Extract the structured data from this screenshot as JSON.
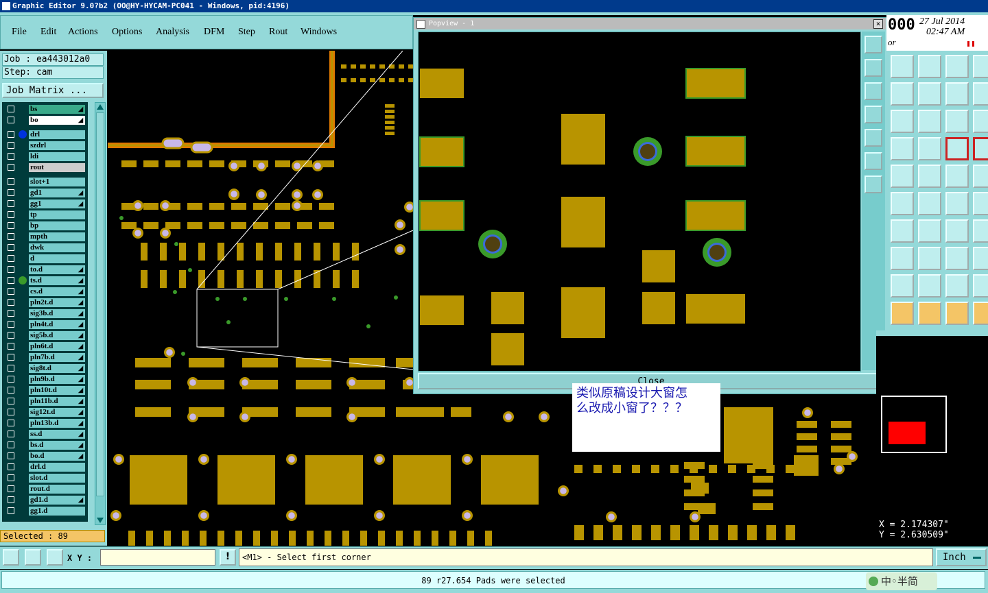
{
  "window": {
    "title": "Graphic Editor 9.0?b2 (OO@HY-HYCAM-PC041 - Windows, pid:4196)"
  },
  "menu": [
    "File",
    "Edit",
    "Actions",
    "Options",
    "Analysis",
    "DFM",
    "Step",
    "Rout",
    "Windows"
  ],
  "job": {
    "job_label": "Job : ea443012a0",
    "step_label": "Step: cam",
    "job_matrix": "Job Matrix ..."
  },
  "layers": [
    {
      "name": "bs",
      "active": true,
      "arrow": true
    },
    {
      "name": "bo",
      "white": true,
      "arrow": true
    },
    {
      "name": "drl",
      "dot": "#0033dd",
      "gap_before": true
    },
    {
      "name": "szdrl"
    },
    {
      "name": "ldi"
    },
    {
      "name": "rout",
      "light": true
    },
    {
      "name": "slot+1",
      "gap_before": true
    },
    {
      "name": "gd1",
      "arrow": true
    },
    {
      "name": "gg1",
      "arrow": true
    },
    {
      "name": "tp"
    },
    {
      "name": "bp"
    },
    {
      "name": "mpth"
    },
    {
      "name": "dwk"
    },
    {
      "name": "d"
    },
    {
      "name": "to.d",
      "arrow": true
    },
    {
      "name": "ts.d",
      "dot": "#3a9a2a",
      "arrow": true
    },
    {
      "name": "cs.d",
      "arrow": true
    },
    {
      "name": "pln2t.d",
      "arrow": true
    },
    {
      "name": "sig3b.d",
      "arrow": true
    },
    {
      "name": "pln4t.d",
      "arrow": true
    },
    {
      "name": "sig5b.d",
      "arrow": true
    },
    {
      "name": "pln6t.d",
      "arrow": true
    },
    {
      "name": "pln7b.d",
      "arrow": true
    },
    {
      "name": "sig8t.d",
      "arrow": true
    },
    {
      "name": "pln9b.d",
      "arrow": true
    },
    {
      "name": "pln10t.d",
      "arrow": true
    },
    {
      "name": "pln11b.d",
      "arrow": true
    },
    {
      "name": "sig12t.d",
      "arrow": true
    },
    {
      "name": "pln13b.d",
      "arrow": true
    },
    {
      "name": "ss.d",
      "arrow": true
    },
    {
      "name": "bs.d",
      "arrow": true
    },
    {
      "name": "bo.d",
      "arrow": true
    },
    {
      "name": "drl.d"
    },
    {
      "name": "slot.d"
    },
    {
      "name": "rout.d"
    },
    {
      "name": "gd1.d",
      "arrow": true
    },
    {
      "name": "gg1.d"
    }
  ],
  "selected_label": "Selected : 89",
  "popview": {
    "title": "Popview - 1",
    "close_label": "Close"
  },
  "clock": {
    "counter": "000",
    "date": "27 Jul 2014",
    "time": "02:47 AM",
    "suffix": "or"
  },
  "annotation": {
    "line1": "类似原稿设计大窗怎",
    "line2": "么改成小窗了？？？"
  },
  "coords": {
    "x": "X = 2.174307\"",
    "y": "Y = 2.630509\""
  },
  "command": {
    "xy_label": "X Y :",
    "xy_value": "",
    "prompt": "<M1> - Select first corner",
    "unit": "Inch"
  },
  "status": {
    "message": "89 r27.654 Pads were selected"
  },
  "ime": {
    "label": "中◦半简"
  },
  "colors": {
    "pad": "#b89400",
    "mask": "#3a9a2a",
    "drill": "#c8b8e8",
    "panel": "#94d9d9",
    "background": "#000000"
  }
}
